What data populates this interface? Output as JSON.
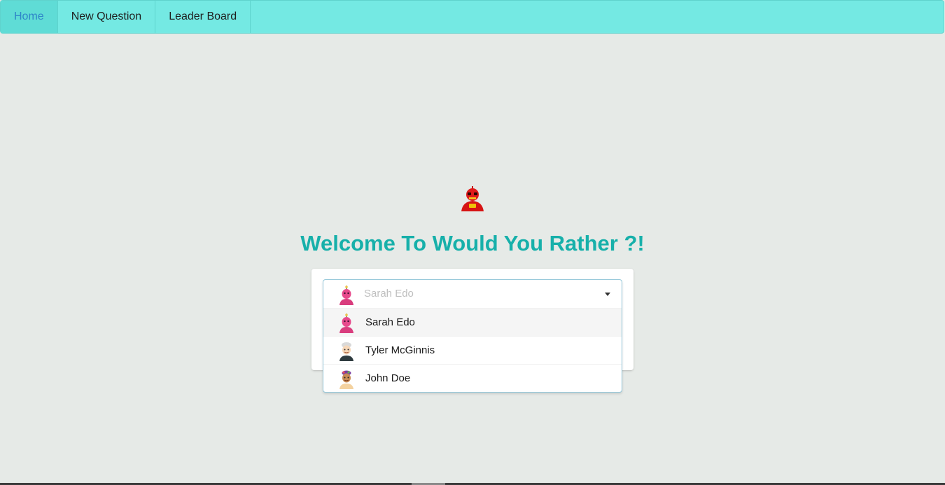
{
  "nav": {
    "items": [
      {
        "label": "Home",
        "active": true
      },
      {
        "label": "New Question",
        "active": false
      },
      {
        "label": "Leader Board",
        "active": false
      }
    ],
    "active_color": "#2f86c9",
    "bar_color": "#74e9e3"
  },
  "mascot": {
    "icon": "robot-mascot-icon"
  },
  "welcome": {
    "title": "Welcome To Would You Rather ?!",
    "color": "#17b0aa"
  },
  "user_select": {
    "placeholder": "Sarah Edo",
    "placeholder_icon": "sarah-avatar-icon",
    "options": [
      {
        "label": "Sarah Edo",
        "icon": "sarah-avatar-icon",
        "selected": true
      },
      {
        "label": "Tyler McGinnis",
        "icon": "tyler-avatar-icon",
        "selected": false
      },
      {
        "label": "John Doe",
        "icon": "john-avatar-icon",
        "selected": false
      }
    ]
  }
}
